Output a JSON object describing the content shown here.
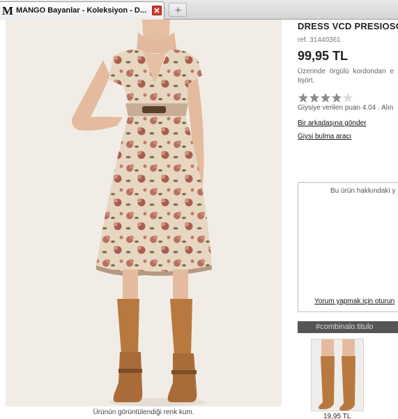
{
  "browser": {
    "tab_title": "MANGO Bayanlar - Koleksiyon - D...",
    "favicon_text": "M",
    "favicon_icon": "mango-logo-icon",
    "close_icon": "close-tab-icon",
    "new_tab_icon": "plus-icon",
    "close_color": "#d83a2c"
  },
  "product": {
    "name": "DRESS VCD PRESIOSO",
    "ref": "ref. 31440361",
    "price": "99,95 TL",
    "description_lines": [
      "Üzerinde örgülü kordondan e",
      "tişört."
    ],
    "rating": {
      "value": 4.04,
      "max": 5,
      "filled_stars": 4
    },
    "rating_text": "Giysiye verilen puan 4.04 . Alın",
    "send_to_friend": "Bir arkadaşına gönder",
    "size_tool": "Giysi bulma aracı"
  },
  "photo": {
    "caption": "Ürünün görüntülendiği renk kum."
  },
  "reviews": {
    "info_text": "Bu ürün hakkındaki y",
    "comment_link": "Yorum yapmak için oturun"
  },
  "combination": {
    "header": "#combinalo.titulo",
    "items": [
      {
        "price": "19,95 TL"
      }
    ]
  },
  "colors": {
    "star_filled": "#8a8a8a",
    "star_empty": "#dcdcdc",
    "combo_header_bg": "#555555",
    "dress_base": "#e7d7c2",
    "flower": "#b9705f",
    "boots": "#b7793f"
  }
}
